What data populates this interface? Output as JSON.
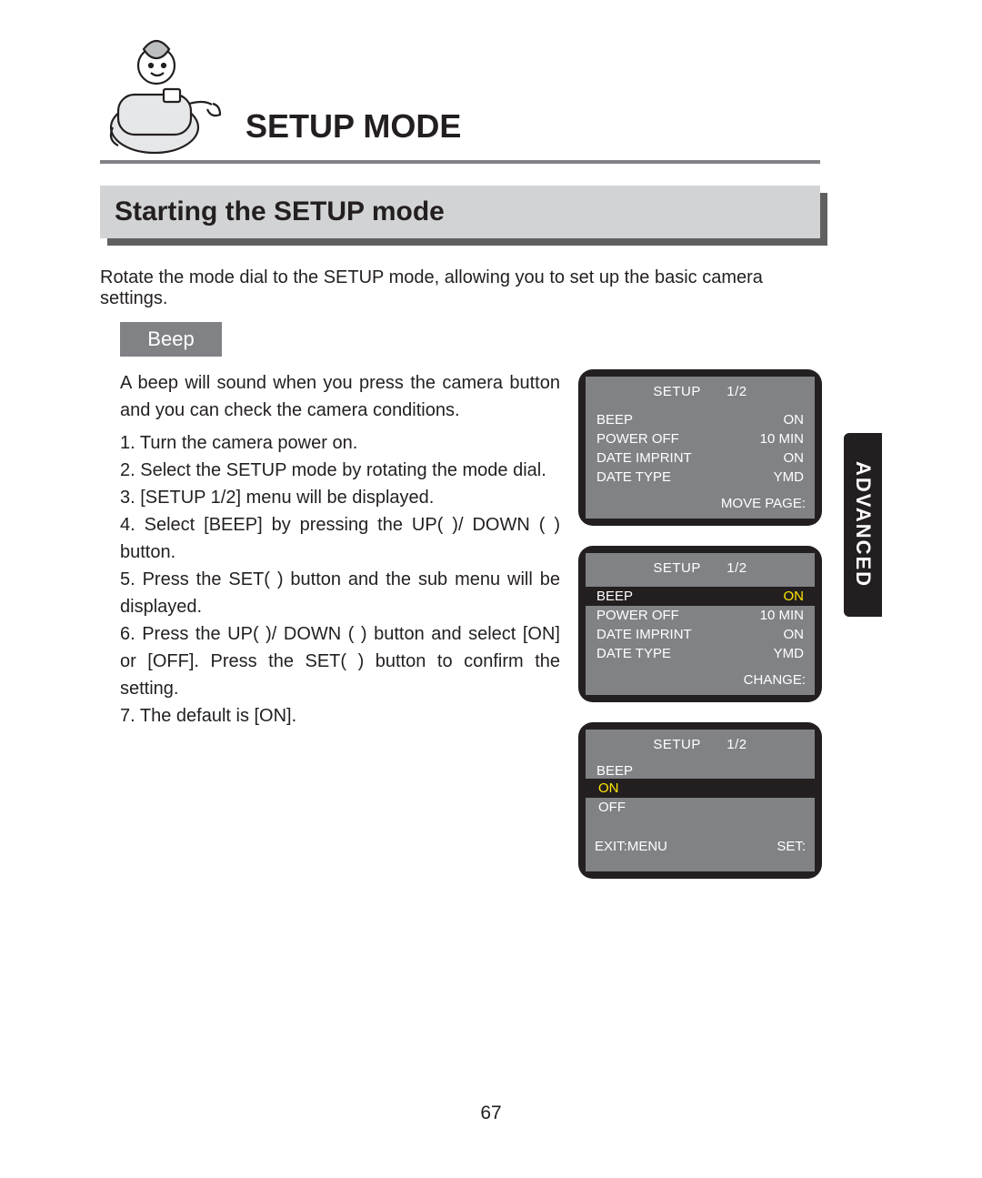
{
  "title": "SETUP MODE",
  "section_heading": "Starting the SETUP mode",
  "intro": "Rotate the mode dial to the SETUP mode, allowing you to set up the basic camera settings.",
  "sub_heading": "Beep",
  "body_intro": "A beep will sound when you press the camera button and you can check the camera conditions.",
  "steps": [
    "1. Turn the camera power on.",
    "2. Select the SETUP mode by rotating the mode dial.",
    "3. [SETUP 1/2] menu will be displayed.",
    "4. Select [BEEP] by pressing the UP(   )/ DOWN (   ) button.",
    "5. Press the SET(   ) button and the sub menu will be displayed.",
    "6. Press the UP(   )/ DOWN (   ) button and select [ON] or [OFF]. Press the SET(   ) button to confirm the setting.",
    "7. The default is [ON]."
  ],
  "screens": [
    {
      "title": "SETUP",
      "page": "1/2",
      "rows": [
        {
          "label": "BEEP",
          "value": "ON",
          "highlight": false
        },
        {
          "label": "POWER OFF",
          "value": "10 MIN",
          "highlight": false
        },
        {
          "label": "DATE IMPRINT",
          "value": "ON",
          "highlight": false
        },
        {
          "label": "DATE TYPE",
          "value": "YMD",
          "highlight": false
        }
      ],
      "footer_right": "MOVE PAGE:"
    },
    {
      "title": "SETUP",
      "page": "1/2",
      "rows": [
        {
          "label": "BEEP",
          "value": "ON",
          "highlight": true
        },
        {
          "label": "POWER OFF",
          "value": "10 MIN",
          "highlight": false
        },
        {
          "label": "DATE IMPRINT",
          "value": "ON",
          "highlight": false
        },
        {
          "label": "DATE TYPE",
          "value": "YMD",
          "highlight": false
        }
      ],
      "footer_right": "CHANGE:"
    },
    {
      "title": "SETUP",
      "page": "1/2",
      "sub_label": "BEEP",
      "options": [
        {
          "label": "ON",
          "selected": true
        },
        {
          "label": "OFF",
          "selected": false
        }
      ],
      "footer_left": "EXIT:MENU",
      "footer_right": "SET:"
    }
  ],
  "side_tab": "ADVANCED",
  "page_number": "67"
}
